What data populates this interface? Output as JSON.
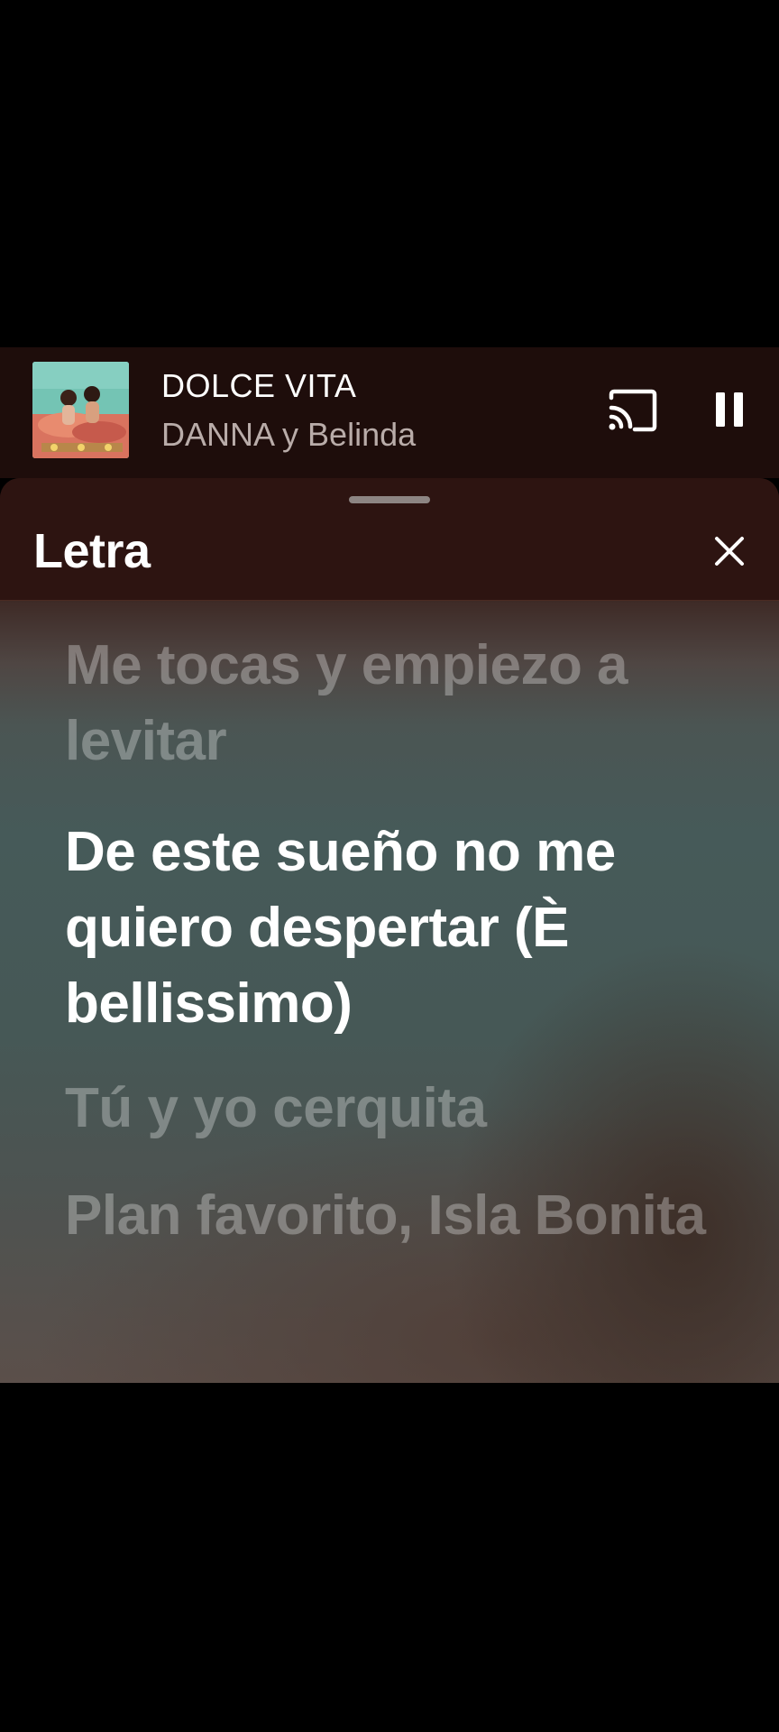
{
  "mini_player": {
    "title": "DOLCE VITA",
    "artist": "DANNA y Belinda",
    "album_art_icon": "album-cover-image",
    "cast_icon": "cast-icon",
    "pause_icon": "pause-icon"
  },
  "lyrics_sheet": {
    "title": "Letra",
    "close_icon": "close-icon",
    "lines": [
      {
        "text": "Me tocas y empiezo a levitar",
        "state": "past"
      },
      {
        "text": "De este sueño no me quiero despertar (È bellissimo)",
        "state": "current"
      },
      {
        "text": "Tú y yo cerquita",
        "state": "upcoming"
      },
      {
        "text": "Plan favorito, Isla Bonita",
        "state": "upcoming"
      }
    ]
  },
  "colors": {
    "background": "#000000",
    "mini_player_bg": "#1e0d0b",
    "sheet_header_bg": "#2d1411",
    "lyric_current": "#ffffff",
    "lyric_dim": "rgba(255,255,255,0.30)",
    "artist_text": "#b9aca9"
  }
}
